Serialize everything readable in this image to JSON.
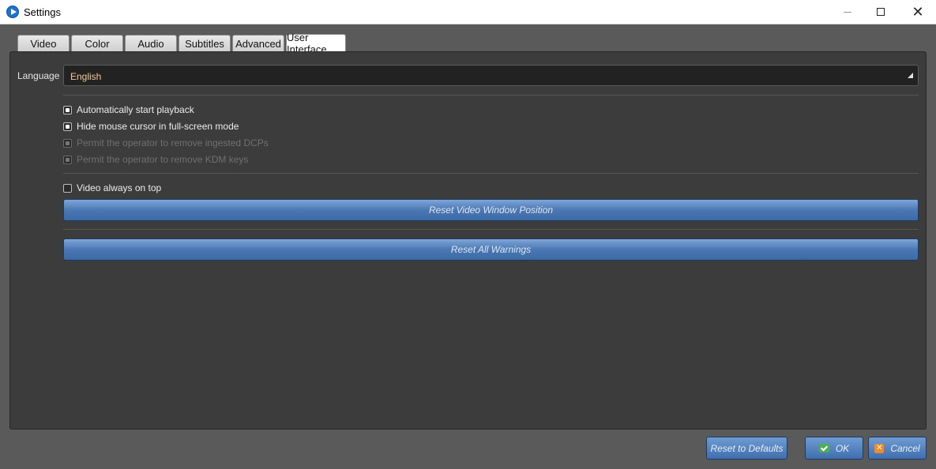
{
  "window": {
    "title": "Settings"
  },
  "tabs": [
    {
      "label": "Video"
    },
    {
      "label": "Color"
    },
    {
      "label": "Audio"
    },
    {
      "label": "Subtitles"
    },
    {
      "label": "Advanced"
    },
    {
      "label": "User Interface"
    }
  ],
  "active_tab": "User Interface",
  "language": {
    "label": "Language",
    "value": "English"
  },
  "options": [
    {
      "label": "Automatically start playback",
      "checked": true,
      "enabled": true
    },
    {
      "label": "Hide mouse cursor in full-screen mode",
      "checked": true,
      "enabled": true
    },
    {
      "label": "Permit the operator to remove ingested DCPs",
      "checked": true,
      "enabled": false
    },
    {
      "label": "Permit the operator to remove KDM keys",
      "checked": true,
      "enabled": false
    }
  ],
  "video_on_top": {
    "label": "Video always on top",
    "checked": false
  },
  "buttons": {
    "reset_video_window": "Reset Video Window Position",
    "reset_warnings": "Reset All Warnings",
    "reset_defaults": "Reset to Defaults",
    "ok": "OK",
    "cancel": "Cancel"
  },
  "colors": {
    "panel_bg": "#3c3c3c",
    "accent_blue": "#4b78b3",
    "language_text": "#f2c89a"
  }
}
